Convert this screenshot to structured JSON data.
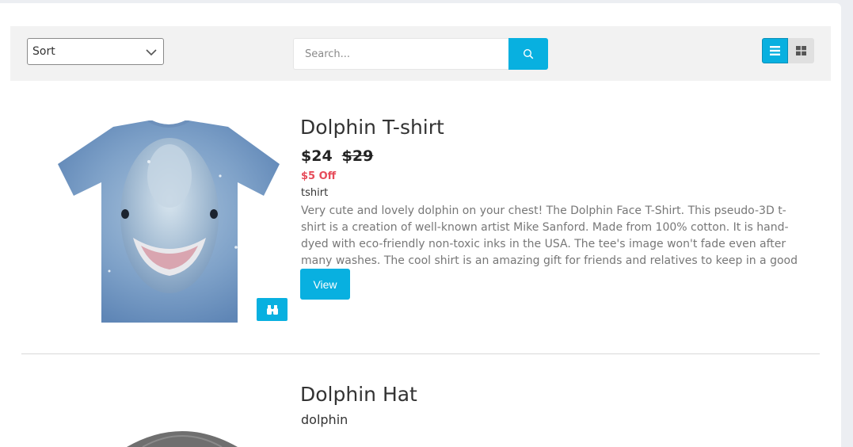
{
  "toolbar": {
    "sort": {
      "selected": "Sort"
    },
    "search": {
      "placeholder": "Search...",
      "button_icon": "search-icon"
    },
    "view_toggle": {
      "active": "list",
      "options": [
        "list",
        "grid"
      ]
    }
  },
  "products": [
    {
      "title": "Dolphin T-shirt",
      "price": "$24",
      "old_price": "$29",
      "discount": "$5 Off",
      "category": "tshirt",
      "description": "Very cute and lovely dolphin on your chest! The Dolphin Face T-Shirt. This pseudo-3D t-shirt is a creation of well-known artist Mike Sanford. Made from 100% cotton. It is hand-dyed with eco-friendly non-toxic inks in the USA. The tee's image won't fade even after many washes. The cool shirt is an amazing gift for friends and relatives to keep in a good mood.",
      "view_label": "View",
      "quick_view_icon": "binoculars-icon"
    },
    {
      "title": "Dolphin Hat",
      "category": "dolphin"
    }
  ],
  "colors": {
    "accent": "#08b0e0",
    "discount": "#e64c5a",
    "toolbar_bg": "#f2f2f2"
  }
}
